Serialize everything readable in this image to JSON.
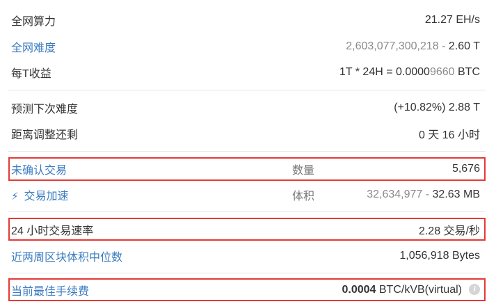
{
  "network": {
    "hashrate": {
      "label": "全网算力",
      "value": "21.27 EH/s"
    },
    "difficulty": {
      "label": "全网难度",
      "value_raw": "2,603,077,300,218",
      "value_sep": " - ",
      "value_short": "2.60 T"
    },
    "income": {
      "label": "每T收益",
      "value_prefix": "1T * 24H = 0.0000",
      "value_muted": "9660",
      "value_suffix": " BTC"
    }
  },
  "adjustment": {
    "next_difficulty": {
      "label": "预测下次难度",
      "value": "(+10.82%) 2.88 T"
    },
    "remaining": {
      "label": "距离调整还剩",
      "value": "0 天 16 小时"
    }
  },
  "mempool": {
    "unconfirmed": {
      "label": "未确认交易",
      "mid_label": "数量",
      "value": "5,676"
    },
    "accelerate": {
      "label": "交易加速",
      "icon": "lightning-icon",
      "mid_label": "体积",
      "value_raw": "32,634,977",
      "value_sep": " - ",
      "value_short": "32.63 MB"
    }
  },
  "stats": {
    "tx_rate": {
      "label": "24 小时交易速率",
      "value": "2.28 交易/秒"
    },
    "median_block": {
      "label": "近两周区块体积中位数",
      "value": "1,056,918 Bytes"
    }
  },
  "fee": {
    "label": "当前最佳手续费",
    "value_bold": "0.0004",
    "value_unit": " BTC/kVB(virtual)",
    "icon": "info-icon",
    "icon_glyph": "i"
  },
  "colors": {
    "link": "#3a7bbf",
    "highlight_border": "#e53935",
    "muted": "#8a8a8a"
  }
}
